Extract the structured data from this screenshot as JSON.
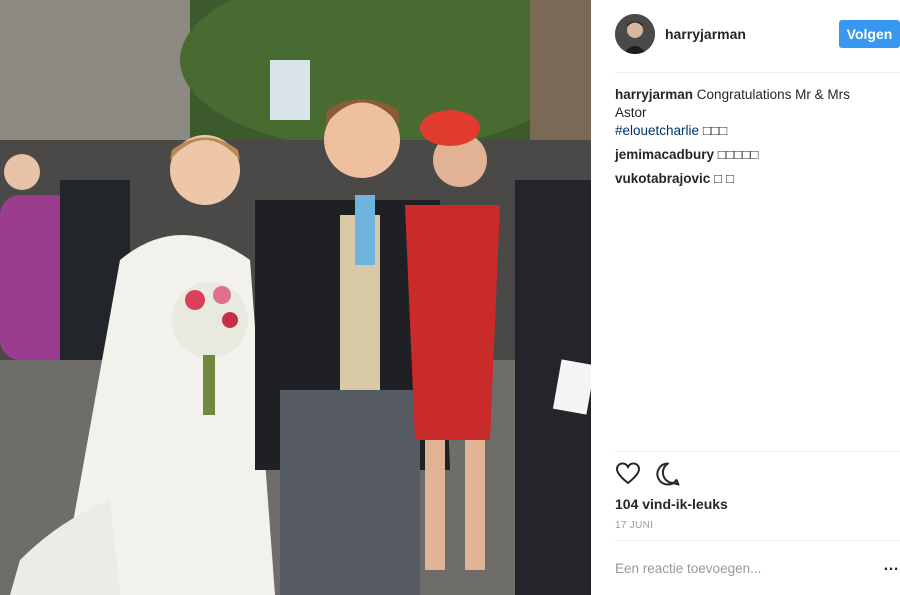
{
  "post": {
    "username": "harryjarman",
    "follow_label": "Volgen",
    "caption": {
      "user": "harryjarman",
      "text": " Congratulations Mr & Mrs Astor",
      "hashtag": "#elouetcharlie",
      "emoji": " □□□"
    },
    "comments": [
      {
        "user": "jemimacadbury",
        "text": " □□□□□"
      },
      {
        "user": "vukotabrajovic",
        "text": " □ □"
      }
    ],
    "likes_text": "104 vind-ik-leuks",
    "date_text": "17 JUNI",
    "comment_placeholder": "Een reactie toevoegen...",
    "more_label": "…"
  },
  "icons": {
    "like": "heart-icon",
    "comment": "comment-bubble-icon",
    "more": "more-options-icon"
  },
  "colors": {
    "follow_button": "#3897f0",
    "hashtag": "#003569",
    "meta": "#999999"
  }
}
